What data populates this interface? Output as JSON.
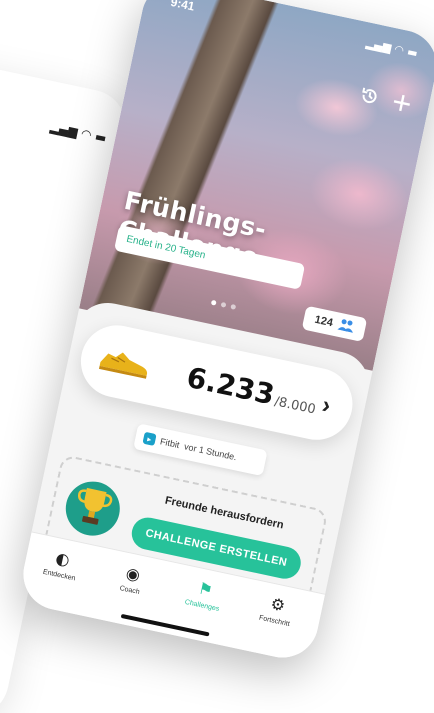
{
  "status": {
    "time": "9:41",
    "icons": "▂▄▆ ◠ ▬"
  },
  "hero": {
    "title": "Frühlings-Challenge",
    "ends_text": "Endet in 20 Tagen",
    "participants": "124",
    "history_icon": "history-icon",
    "add_icon": "plus-icon"
  },
  "steps": {
    "value": "6.233",
    "goal": "/8.000",
    "chevron": "›"
  },
  "sync": {
    "source": "Fitbit",
    "time": "vor 1 Stunde."
  },
  "friends": {
    "label": "Freunde herausfordern",
    "button": "CHALLENGE ERSTELLEN"
  },
  "tabs": [
    {
      "label": "Entdecken",
      "icon": "compass-icon"
    },
    {
      "label": "Coach",
      "icon": "stopwatch-icon"
    },
    {
      "label": "Challenges",
      "icon": "flag-icon",
      "active": true
    },
    {
      "label": "Fortschritt",
      "icon": "gear-icon"
    }
  ],
  "background_phone_status": "▂▄▆ ◠ ▬",
  "colors": {
    "accent": "#27c29a",
    "fitbit": "#1aa0c9",
    "participants_icon": "#3a8ee6"
  }
}
